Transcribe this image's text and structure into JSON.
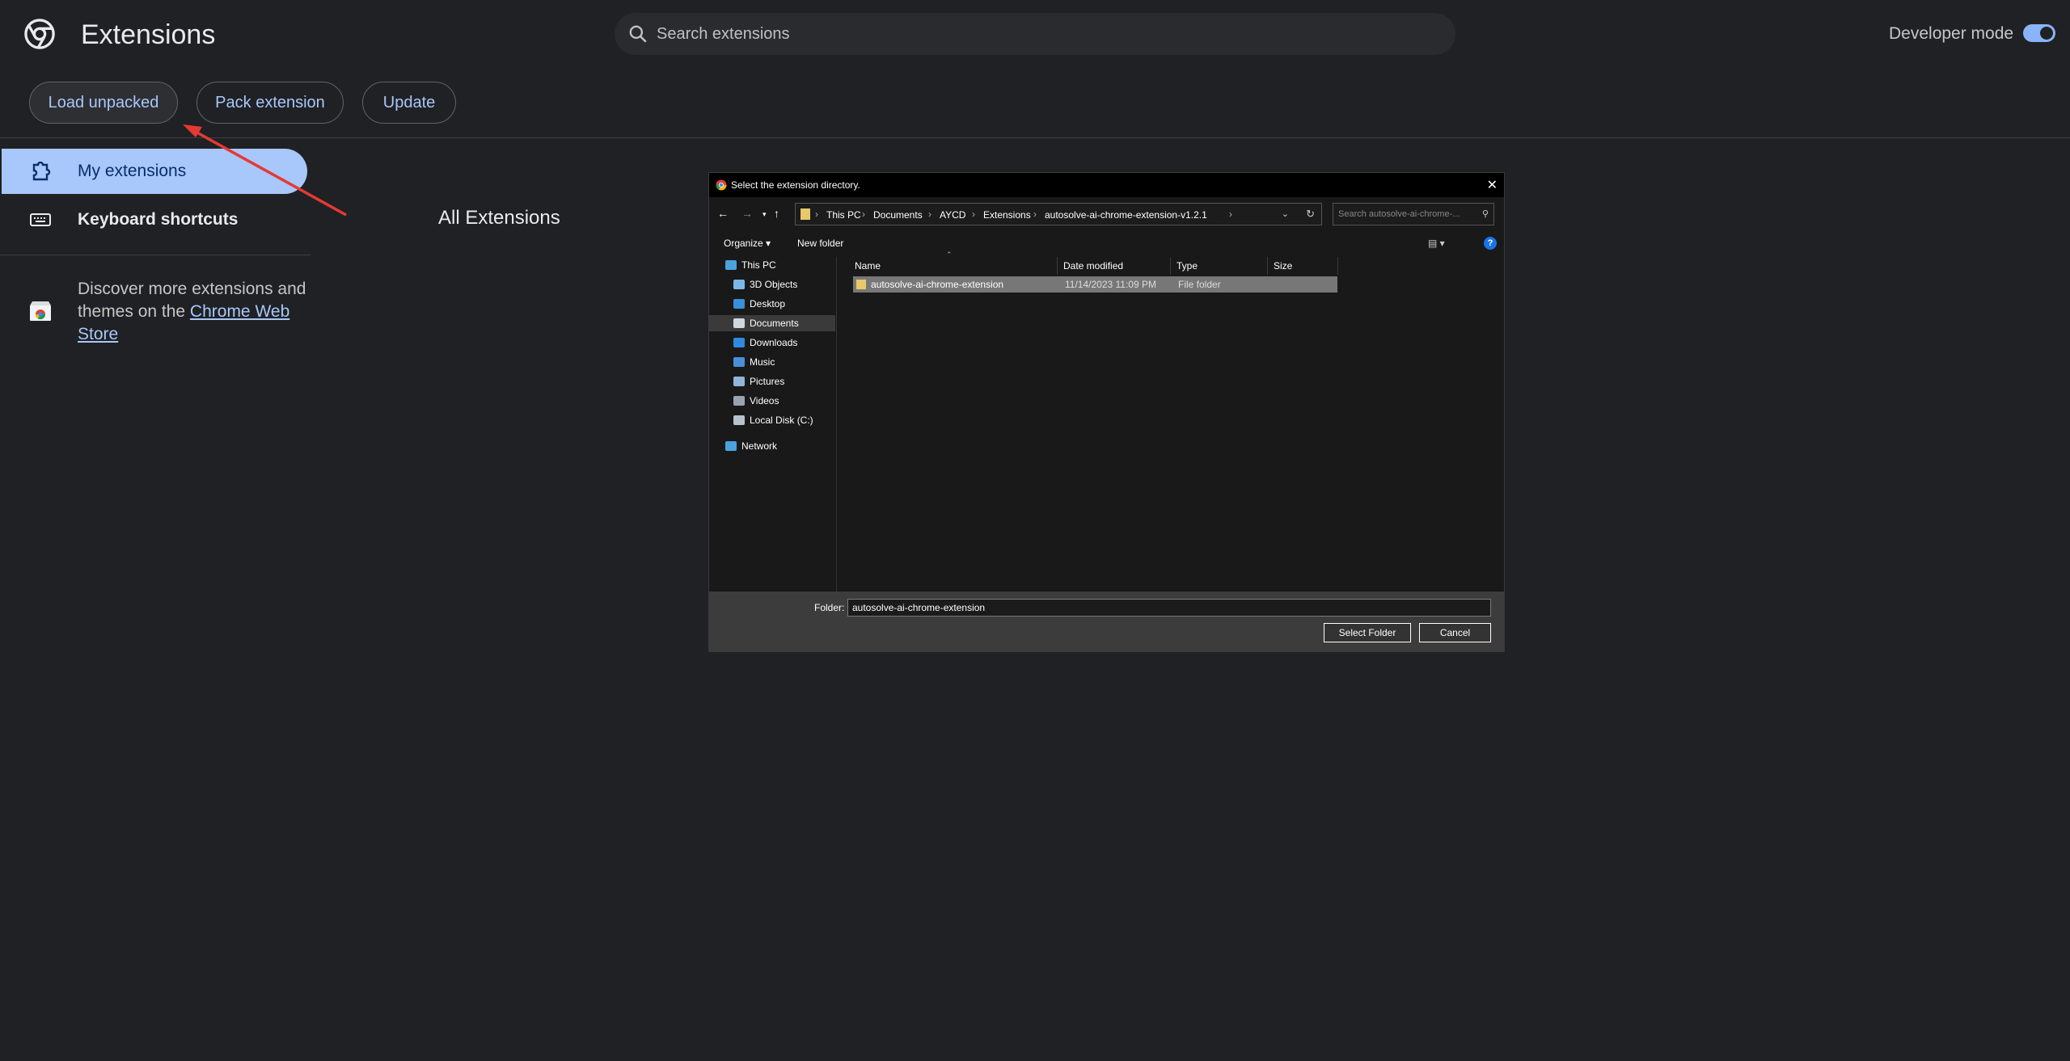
{
  "header": {
    "title": "Extensions",
    "search_placeholder": "Search extensions",
    "developer_mode_label": "Developer mode",
    "developer_mode_on": true
  },
  "toolbar": {
    "load_unpacked": "Load unpacked",
    "pack_extension": "Pack extension",
    "update": "Update"
  },
  "sidebar": {
    "items": [
      {
        "label": "My extensions",
        "icon": "extension-puzzle-icon",
        "selected": true
      },
      {
        "label": "Keyboard shortcuts",
        "icon": "keyboard-icon",
        "selected": false
      }
    ],
    "discover_text": "Discover more extensions and themes on the ",
    "webstore_link": "Chrome Web Store"
  },
  "main": {
    "section_title": "All Extensions"
  },
  "dialog": {
    "title": "Select the extension directory.",
    "breadcrumbs": [
      "This PC",
      "Documents",
      "AYCD",
      "Extensions",
      "autosolve-ai-chrome-extension-v1.2.1"
    ],
    "search_placeholder": "Search autosolve-ai-chrome-...",
    "organize": "Organize",
    "new_folder": "New folder",
    "tree": [
      {
        "label": "This PC",
        "icon": "computer-icon",
        "selected": false
      },
      {
        "label": "3D Objects",
        "icon": "3d-objects-icon",
        "selected": false
      },
      {
        "label": "Desktop",
        "icon": "desktop-icon",
        "selected": false
      },
      {
        "label": "Documents",
        "icon": "documents-icon",
        "selected": true
      },
      {
        "label": "Downloads",
        "icon": "downloads-icon",
        "selected": false
      },
      {
        "label": "Music",
        "icon": "music-icon",
        "selected": false
      },
      {
        "label": "Pictures",
        "icon": "pictures-icon",
        "selected": false
      },
      {
        "label": "Videos",
        "icon": "videos-icon",
        "selected": false
      },
      {
        "label": "Local Disk (C:)",
        "icon": "disk-icon",
        "selected": false
      },
      {
        "label": "Network",
        "icon": "network-icon",
        "selected": false
      }
    ],
    "columns": [
      "Name",
      "Date modified",
      "Type",
      "Size"
    ],
    "rows": [
      {
        "name": "autosolve-ai-chrome-extension",
        "date": "11/14/2023 11:09 PM",
        "type": "File folder",
        "size": ""
      }
    ],
    "folder_label": "Folder:",
    "folder_value": "autosolve-ai-chrome-extension",
    "select_button": "Select Folder",
    "cancel_button": "Cancel",
    "close_glyph": "✕"
  },
  "colors": {
    "background": "#202124",
    "accent": "#a8c7fa",
    "annotation_arrow": "#e53935"
  }
}
